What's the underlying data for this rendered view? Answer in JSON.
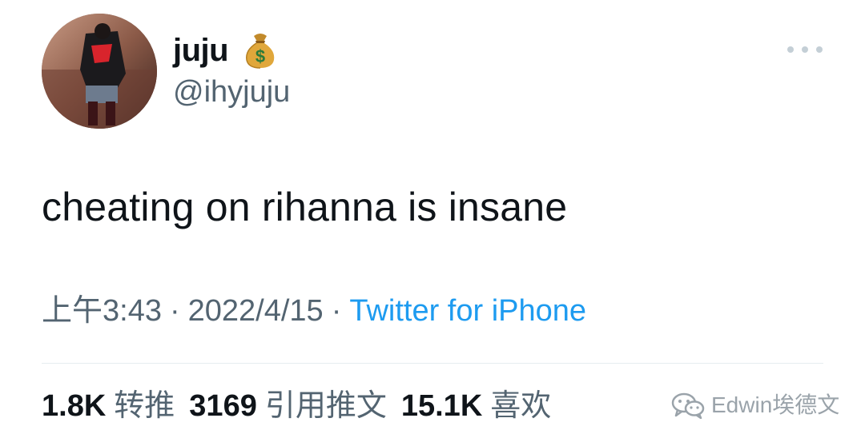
{
  "tweet": {
    "author": {
      "display_name": "juju",
      "handle": "@ihyjuju",
      "badge_icon": "moneybag-icon"
    },
    "text": "cheating on rihanna is insane",
    "meta": {
      "time": "上午3:43",
      "separator": "·",
      "date": "2022/4/15",
      "source": "Twitter for iPhone"
    },
    "stats": [
      {
        "count": "1.8K",
        "label": "转推"
      },
      {
        "count": "3169",
        "label": "引用推文"
      },
      {
        "count": "15.1K",
        "label": "喜欢"
      }
    ]
  },
  "watermark": {
    "text": "Edwin埃德文",
    "icon": "wechat-icon"
  },
  "colors": {
    "text_primary": "#0f1419",
    "text_secondary": "#536471",
    "accent": "#1d9bf0",
    "divider": "#e6ecf0"
  }
}
